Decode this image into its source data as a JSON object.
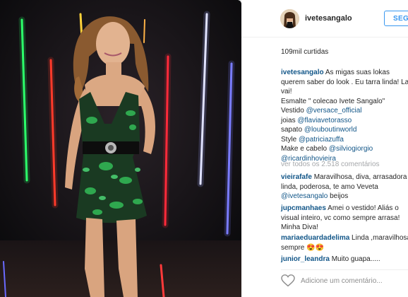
{
  "header": {
    "username": "ivetesangalo",
    "follow_label": "SEGUIR"
  },
  "likes": "109mil curtidas",
  "caption": {
    "username": "ivetesangalo",
    "line1_text": "As migas suas lokas",
    "line2": "querem saber do look . Eu tarra linda! La",
    "line3": "vai!",
    "line4": "Esmalte \" colecao Ivete Sangalo\"",
    "vestido_label": "Vestido",
    "vestido_mention": "@versace_official",
    "joias_label": "joias",
    "joias_mention": "@flaviavetorasso",
    "sapato_label": "sapato",
    "sapato_mention": "@louboutinworld",
    "style_label": "Style",
    "style_mention": "@patriciazuffa",
    "make_label": "Make e cabelo",
    "make_mention": "@silviogiorgio",
    "last_mention": "@ricardinhovieira"
  },
  "view_all": "ver todos os 2.518 comentários",
  "comments": [
    {
      "username": "vieirafafe",
      "line1": "Maravilhosa, diva, arrasadora",
      "line2": "linda, poderosa, te amo Veveta",
      "mention": "@ivetesangalo",
      "line3_tail": " beijos"
    },
    {
      "username": "jupcmanhaes",
      "line1": "Amei o vestido! Aliás o",
      "line2": "visual inteiro, vc como sempre arrasa!",
      "line3": "Minha Diva!"
    },
    {
      "username": "mariaeduardadelima",
      "line1": "Linda ,maravilhosa",
      "line2": "sempre 😍😍"
    },
    {
      "username": "junior_leandra",
      "line1": "Muito guapa....."
    }
  ],
  "add_comment_placeholder": "Adicione um comentário...",
  "colors": {
    "accent_blue": "#3897f0",
    "username_blue": "#125688",
    "dress_green": "#2fa84f",
    "neon_red": "#ff2a2a",
    "neon_green": "#2cff6a"
  },
  "icons": {
    "like": "heart-outline-icon"
  }
}
